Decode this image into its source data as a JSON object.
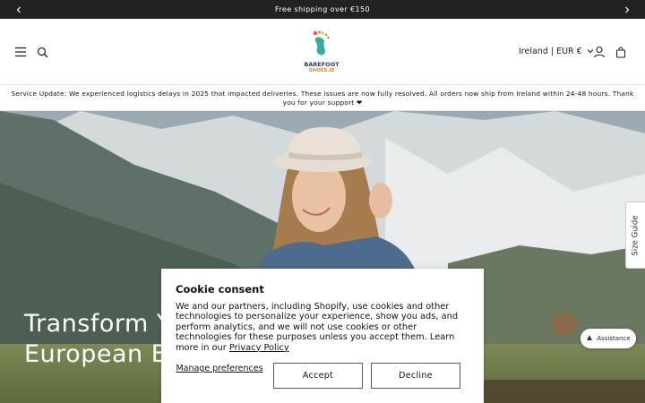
{
  "announcement": {
    "text": "Free shipping over €150",
    "prev_icon": "chevron-left-icon",
    "next_icon": "chevron-right-icon"
  },
  "header": {
    "logo_line1": "BAREFOOT",
    "logo_line2": "SHOES.IE",
    "country_selector": "Ireland | EUR €",
    "icons": [
      "menu-icon",
      "search-icon",
      "chevron-down-icon",
      "account-icon",
      "cart-icon"
    ]
  },
  "service_update": "Service Update: We experienced logistics delays in 2025 that impacted deliveries. These issues are now fully resolved. All orders now ship from Ireland within 24-48 hours. Thank you for your support ❤",
  "hero": {
    "title": "Transform Your Feet with European Barefoot Shoes"
  },
  "size_guide": {
    "label": "Size Guide"
  },
  "assistance": {
    "label": "Assistance"
  },
  "cookie": {
    "title": "Cookie consent",
    "body": "We and our partners, including Shopify, use cookies and other technologies to personalize your experience, show you ads, and perform analytics, and we will not use cookies or other technologies for these purposes unless you accept them. Learn more in our ",
    "policy_link": "Privacy Policy",
    "manage_label": "Manage preferences",
    "accept_label": "Accept",
    "decline_label": "Decline"
  },
  "colors": {
    "announcement_bg": "#222222",
    "logo_navy": "#2b3a67",
    "logo_orange": "#e08a2c",
    "logo_teal": "#3aa9a0"
  }
}
